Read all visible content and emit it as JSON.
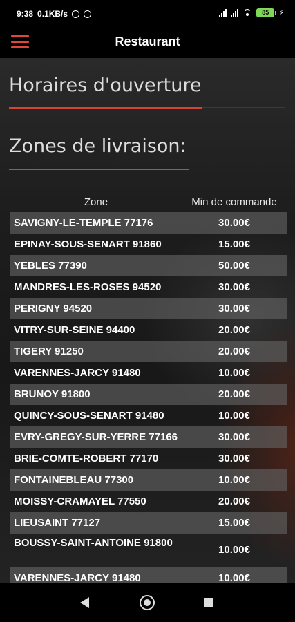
{
  "status_bar": {
    "time": "9:38",
    "speed": "0.1KB/s",
    "battery": "85"
  },
  "app_bar": {
    "title": "Restaurant",
    "menu_icon": "hamburger-menu-icon",
    "accent_color": "#e0463a"
  },
  "sections": {
    "opening_hours": "Horaires d'ouverture",
    "delivery_zones": "Zones de livraison:"
  },
  "table": {
    "columns": [
      "Zone",
      "Min de commande"
    ],
    "rows": [
      {
        "zone": "SAVIGNY-LE-TEMPLE 77176",
        "min": "30.00€"
      },
      {
        "zone": "EPINAY-SOUS-SENART 91860",
        "min": "15.00€"
      },
      {
        "zone": "YEBLES 77390",
        "min": "50.00€"
      },
      {
        "zone": "MANDRES-LES-ROSES 94520",
        "min": "30.00€"
      },
      {
        "zone": "PERIGNY 94520",
        "min": "30.00€"
      },
      {
        "zone": "VITRY-SUR-SEINE 94400",
        "min": "20.00€"
      },
      {
        "zone": "TIGERY 91250",
        "min": "20.00€"
      },
      {
        "zone": "VARENNES-JARCY 91480",
        "min": "10.00€"
      },
      {
        "zone": "BRUNOY 91800",
        "min": "20.00€"
      },
      {
        "zone": "QUINCY-SOUS-SENART 91480",
        "min": "10.00€"
      },
      {
        "zone": "EVRY-GREGY-SUR-YERRE 77166",
        "min": "30.00€"
      },
      {
        "zone": "BRIE-COMTE-ROBERT 77170",
        "min": "30.00€"
      },
      {
        "zone": "FONTAINEBLEAU 77300",
        "min": "10.00€"
      },
      {
        "zone": "MOISSY-CRAMAYEL 77550",
        "min": "20.00€"
      },
      {
        "zone": "LIEUSAINT 77127",
        "min": "15.00€"
      },
      {
        "zone": "BOUSSY-SAINT-ANTOINE 91800",
        "min": "10.00€"
      },
      {
        "zone": "VARENNES-JARCY 91480",
        "min": "10.00€"
      }
    ]
  },
  "nav_bar": {
    "back_icon": "back-triangle-icon",
    "home_icon": "home-circle-icon",
    "recent_icon": "recent-square-icon"
  }
}
